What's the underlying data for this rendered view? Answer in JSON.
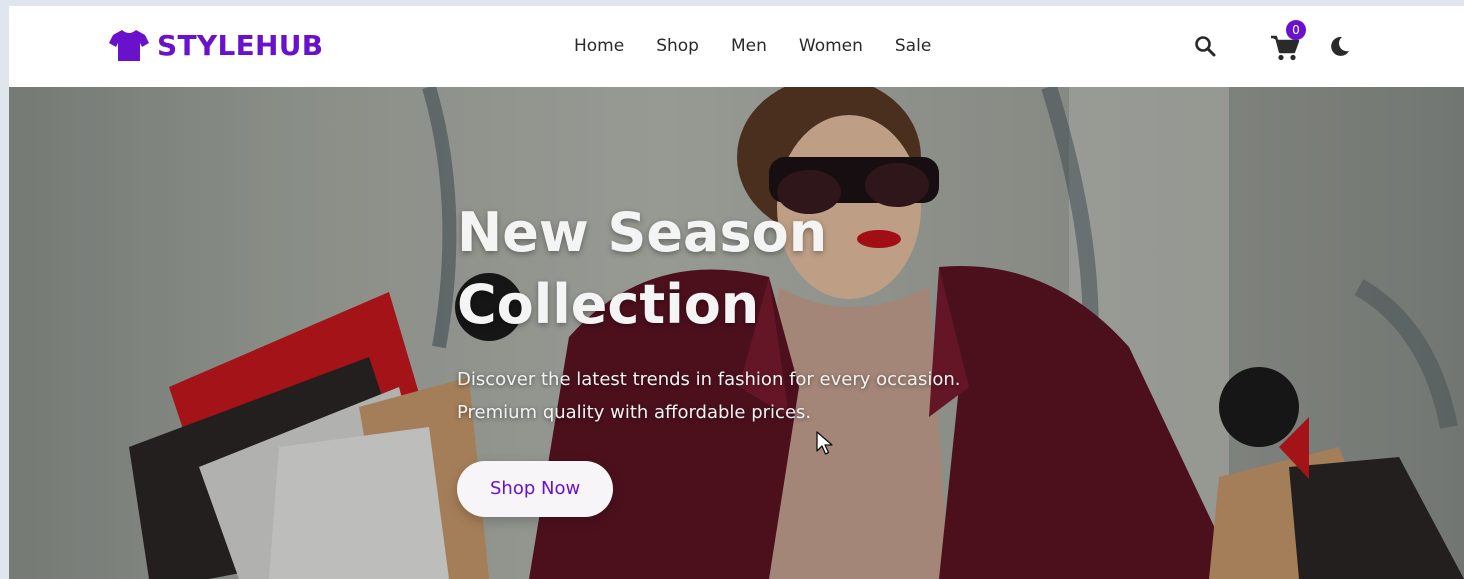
{
  "brand": {
    "name": "STYLEHUB",
    "icon": "tshirt-icon",
    "color": "#6a11cb"
  },
  "nav": {
    "links": [
      "Home",
      "Shop",
      "Men",
      "Women",
      "Sale"
    ]
  },
  "actions": {
    "search_icon": "search-icon",
    "cart_icon": "cart-icon",
    "cart_count": "0",
    "theme_icon": "moon-icon"
  },
  "hero": {
    "title_line1": "New Season",
    "title_line2": "Collection",
    "subtitle_line1": "Discover the latest trends in fashion for every occasion.",
    "subtitle_line2": "Premium quality with affordable prices.",
    "cta_label": "Shop Now"
  },
  "colors": {
    "accent": "#6a11cb",
    "nav_text": "#2a2a2a",
    "hero_text": "#f4f4f4"
  }
}
